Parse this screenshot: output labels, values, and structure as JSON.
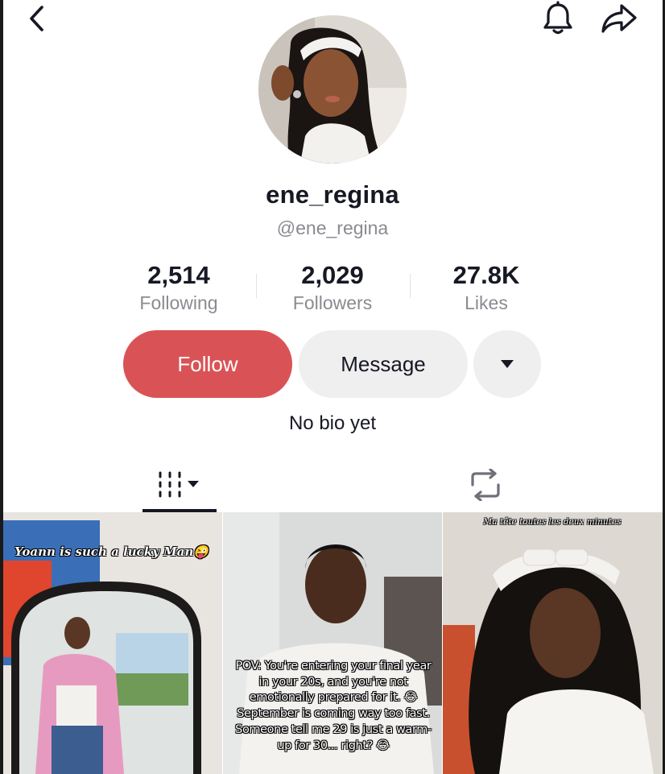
{
  "profile": {
    "username": "ene_regina",
    "handle": "@ene_regina",
    "bio": "No bio yet"
  },
  "stats": [
    {
      "value": "2,514",
      "label": "Following"
    },
    {
      "value": "2,029",
      "label": "Followers"
    },
    {
      "value": "27.8K",
      "label": "Likes"
    }
  ],
  "actions": {
    "follow_label": "Follow",
    "message_label": "Message"
  },
  "icons": {
    "back": "chevron-left-icon",
    "notifications": "bell-icon",
    "share": "share-arrow-icon",
    "more": "caret-down-icon",
    "videos_tab": "grid-bars-icon",
    "reposts_tab": "repost-icon"
  },
  "colors": {
    "follow_button": "#d95356",
    "secondary_button": "#efefef",
    "muted_text": "#8a8b91"
  },
  "videos": [
    {
      "caption": "Yoann is such a lucky Man😜"
    },
    {
      "caption": "POV: You're entering your final year in your 20s, and you're not emotionally prepared for it. 😂 September is coming way too fast. Someone tell me 29 is just a warm-up for 30... right? 😂"
    },
    {
      "caption": "Ma tête toutes les deux minutes"
    }
  ]
}
